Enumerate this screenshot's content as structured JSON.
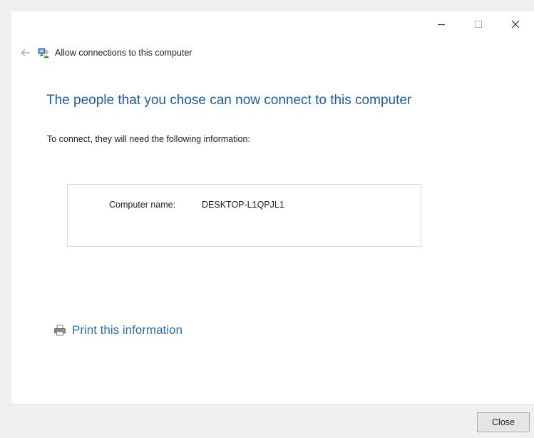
{
  "window": {
    "title": "Allow connections to this computer",
    "caption_buttons": [
      {
        "name": "minimize-button",
        "icon": "minimize-icon"
      },
      {
        "name": "maximize-button",
        "icon": "maximize-icon"
      },
      {
        "name": "close-window-button",
        "icon": "close-icon"
      }
    ]
  },
  "nav": {
    "back_icon": "back-arrow-icon",
    "app_icon": "network-users-icon"
  },
  "main": {
    "headline": "The people that you chose can now connect to this computer",
    "instructions": "To connect, they will need the following information:",
    "info": {
      "label": "Computer name:",
      "value": "DESKTOP-L1QPJL1"
    },
    "print_link": {
      "label": "Print this information",
      "icon": "printer-icon"
    }
  },
  "footer": {
    "close_label": "Close"
  },
  "colors": {
    "headline": "#1b5b9e",
    "link": "#2a6fb9",
    "footer_bg": "#f0f0f0"
  }
}
